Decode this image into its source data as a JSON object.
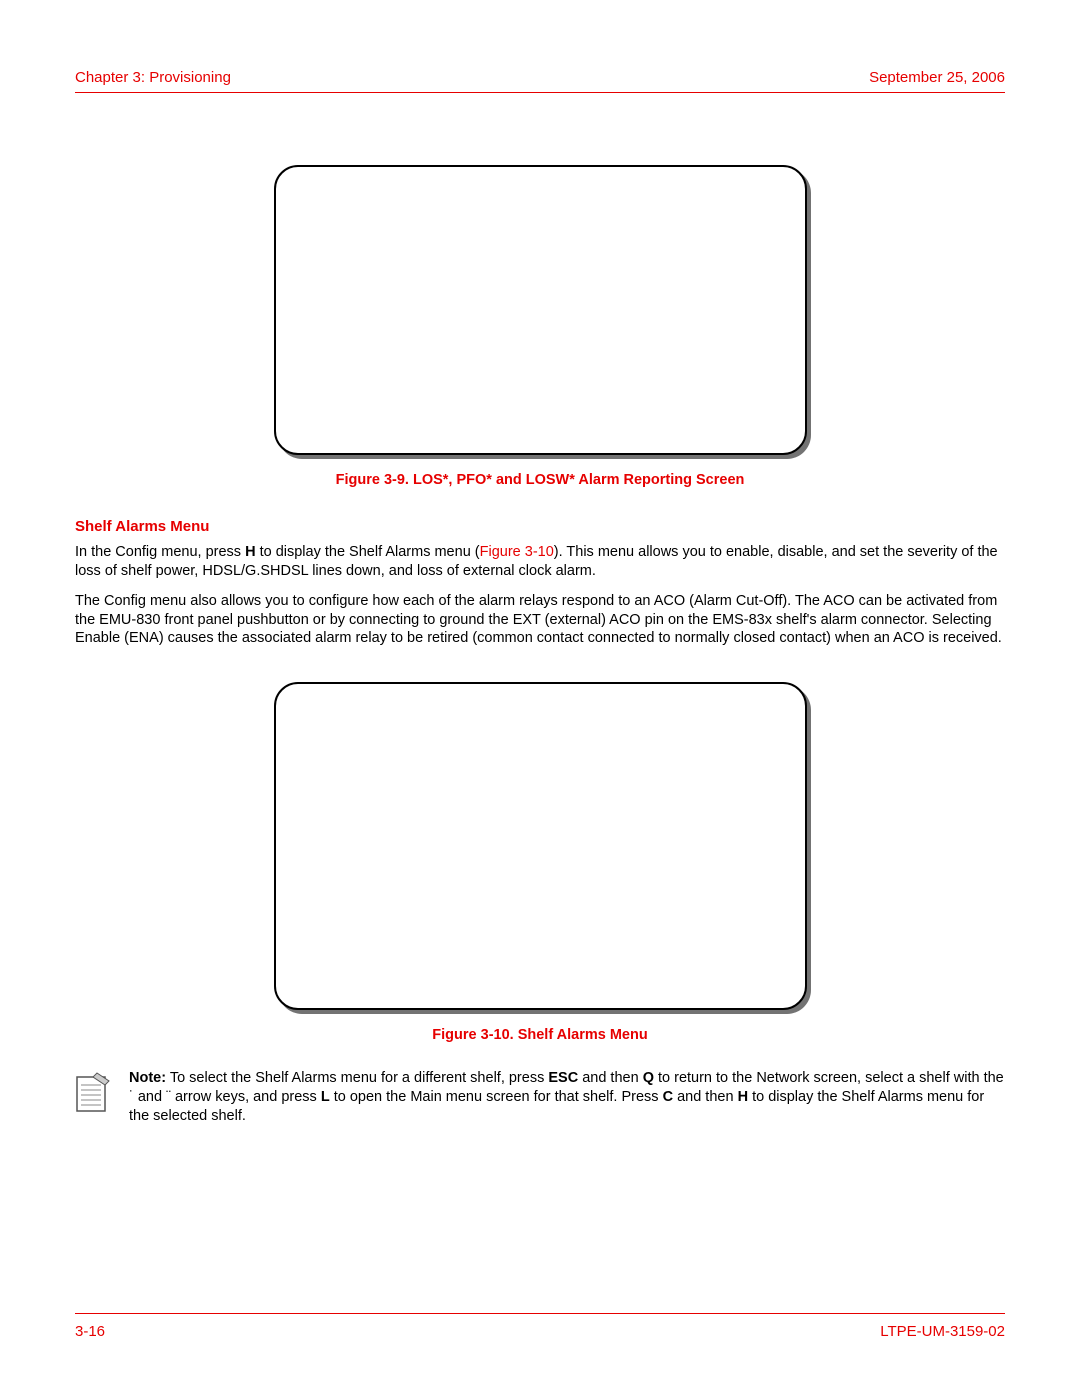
{
  "header": {
    "chapter": "Chapter 3: Provisioning",
    "date": "September 25, 2006"
  },
  "figure1": {
    "caption": "Figure 3-9. LOS*, PFO* and LOSW* Alarm Reporting Screen"
  },
  "section": {
    "heading": "Shelf Alarms Menu"
  },
  "para1": {
    "lead": "In the Config menu, press ",
    "key": "H",
    "mid": " to display the Shelf Alarms menu (",
    "xref": "Figure 3-10",
    "tail": "). This menu allows you to enable, disable, and set the severity of the loss of shelf power, HDSL/G.SHDSL lines down, and loss of external clock alarm."
  },
  "para2": "The Config menu also allows you to configure how each of the alarm relays respond to an ACO (Alarm Cut-Off). The ACO can be activated from the EMU-830 front panel pushbutton or by connecting to ground the EXT (external) ACO pin on the EMS-83x shelf's alarm connector. Selecting Enable (ENA) causes the associated alarm relay to be retired (common contact connected to normally closed contact) when an ACO is received.",
  "figure2": {
    "caption": "Figure 3-10. Shelf Alarms Menu"
  },
  "note": {
    "label": "Note:",
    "t1": " To select the Shelf Alarms menu for a different shelf, press ",
    "k1": "ESC",
    "t2": " and then ",
    "k2": "Q",
    "t3": " to return to the Network screen, select a shelf with the ",
    "arrow1": "˙",
    "t4": " and ",
    "arrow2": "¨",
    "t5": " arrow keys, and press ",
    "k3": "L",
    "t6": " to open the Main menu screen for that shelf. Press ",
    "k4": "C",
    "t7": " and then ",
    "k5": "H",
    "t8": " to display the Shelf Alarms menu for the selected shelf."
  },
  "footer": {
    "page": "3-16",
    "doc": "LTPE-UM-3159-02"
  }
}
